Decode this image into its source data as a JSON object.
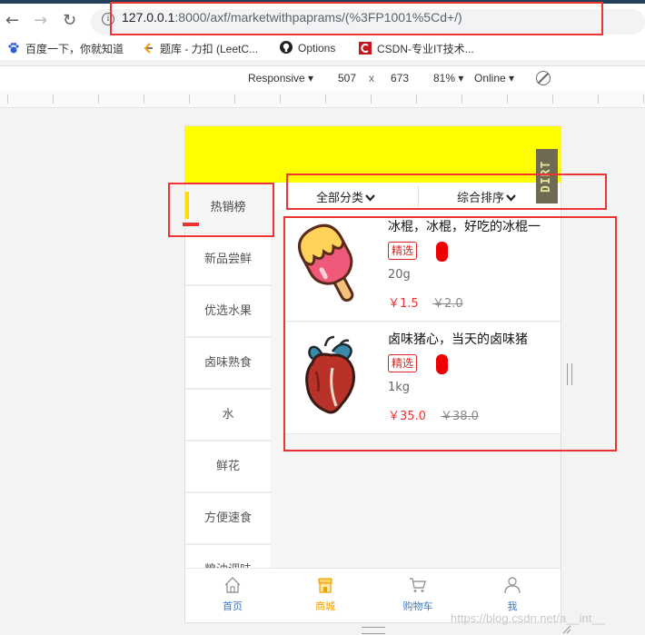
{
  "browser": {
    "url_host": "127.0.0.1",
    "url_rest": ":8000/axf/marketwithpaprams/(%3FP1001%5Cd+/)",
    "bookmarks": [
      {
        "label": "百度一下，你就知道",
        "icon": "paw-icon"
      },
      {
        "label": "题库 - 力扣 (LeetC...",
        "icon": "leetcode-icon"
      },
      {
        "label": "Options",
        "icon": "github-icon"
      },
      {
        "label": "CSDN-专业IT技术...",
        "icon": "csdn-icon"
      }
    ]
  },
  "devtools": {
    "device": "Responsive ▾",
    "width": "507",
    "times": "x",
    "height": "673",
    "zoom": "81% ▾",
    "network": "Online ▾"
  },
  "app": {
    "sidebar": [
      "热销榜",
      "新品尝鲜",
      "优选水果",
      "卤味熟食",
      "水",
      "鲜花",
      "方便速食",
      "粮油调味"
    ],
    "sort": {
      "category": "全部分类",
      "order": "综合排序"
    },
    "goods": [
      {
        "name": "冰棍，冰棍，好吃的冰棍一",
        "tag": "精选",
        "spec": "20g",
        "price": "￥1.5",
        "old_price": "￥2.0",
        "image": "popsicle-icon"
      },
      {
        "name": "卤味猪心，当天的卤味猪",
        "tag": "精选",
        "spec": "1kg",
        "price": "￥35.0",
        "old_price": "￥38.0",
        "image": "heart-icon"
      }
    ],
    "tabs": [
      {
        "label": "首页",
        "icon": "home-icon"
      },
      {
        "label": "商城",
        "icon": "shop-icon"
      },
      {
        "label": "购物车",
        "icon": "cart-icon"
      },
      {
        "label": "我",
        "icon": "user-icon"
      }
    ],
    "sticker": "DIRT"
  },
  "watermark": "https://blog.csdn.net/a__int__",
  "colors": {
    "header_yellow": "#ffff00",
    "annotation_red": "#e33333",
    "price_red": "#e33333",
    "tab_active": "#f0a000",
    "tab_inactive": "#3a78c6"
  }
}
